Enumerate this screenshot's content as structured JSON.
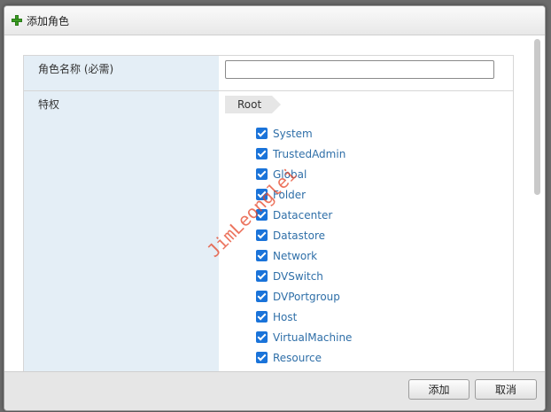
{
  "dialog": {
    "title": "添加角色",
    "icon": "plus-icon"
  },
  "form": {
    "role_name_label": "角色名称 (必需)",
    "role_name_value": "",
    "privileges_label": "特权",
    "breadcrumb": [
      "Root"
    ],
    "privileges": [
      {
        "label": "System",
        "checked": true
      },
      {
        "label": "TrustedAdmin",
        "checked": true
      },
      {
        "label": "Global",
        "checked": true
      },
      {
        "label": "Folder",
        "checked": true
      },
      {
        "label": "Datacenter",
        "checked": true
      },
      {
        "label": "Datastore",
        "checked": true
      },
      {
        "label": "Network",
        "checked": true
      },
      {
        "label": "DVSwitch",
        "checked": true
      },
      {
        "label": "DVPortgroup",
        "checked": true
      },
      {
        "label": "Host",
        "checked": true
      },
      {
        "label": "VirtualMachine",
        "checked": true
      },
      {
        "label": "Resource",
        "checked": true
      }
    ]
  },
  "watermark": "JimLeonglei",
  "footer": {
    "add_label": "添加",
    "cancel_label": "取消"
  },
  "colors": {
    "checkbox": "#1a73d9",
    "label_bg": "#e4eef6",
    "link_text": "#2f6fa8"
  }
}
